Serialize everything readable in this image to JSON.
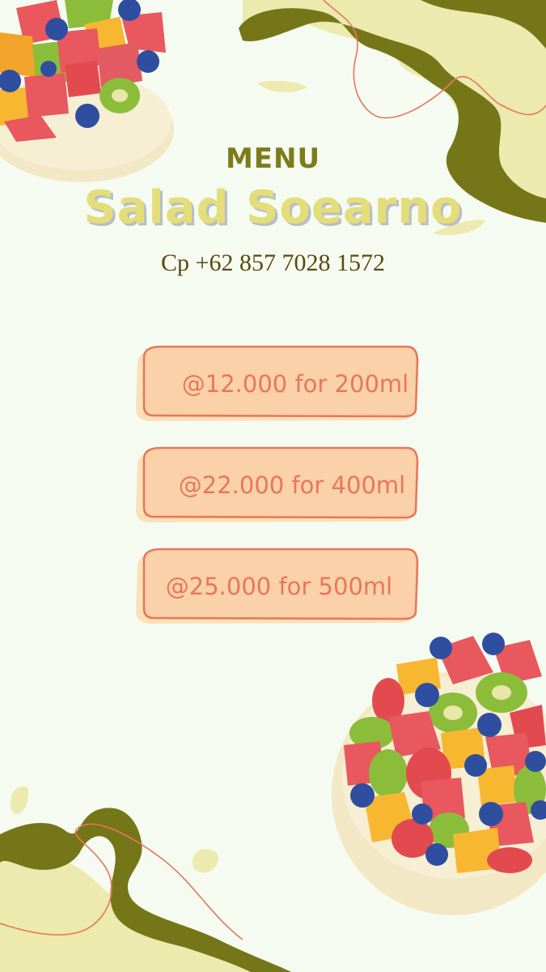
{
  "header": {
    "label": "MENU",
    "title": "Salad Soearno",
    "phone": "Cp +62 857 7028 1572"
  },
  "prices": [
    {
      "label": "@12.000 for 200ml"
    },
    {
      "label": "@22.000 for 400ml"
    },
    {
      "label": "@25.000 for 500ml"
    }
  ],
  "colors": {
    "background": "#f6fbf1",
    "olive": "#7c7d19",
    "pale_yellow": "#eceaae",
    "title_yellow": "#e3dd7a",
    "peach": "#fbd6b0",
    "coral": "#e8775a"
  },
  "icons": [
    "fruit-bowl-icon",
    "fruit-bowl-icon"
  ]
}
